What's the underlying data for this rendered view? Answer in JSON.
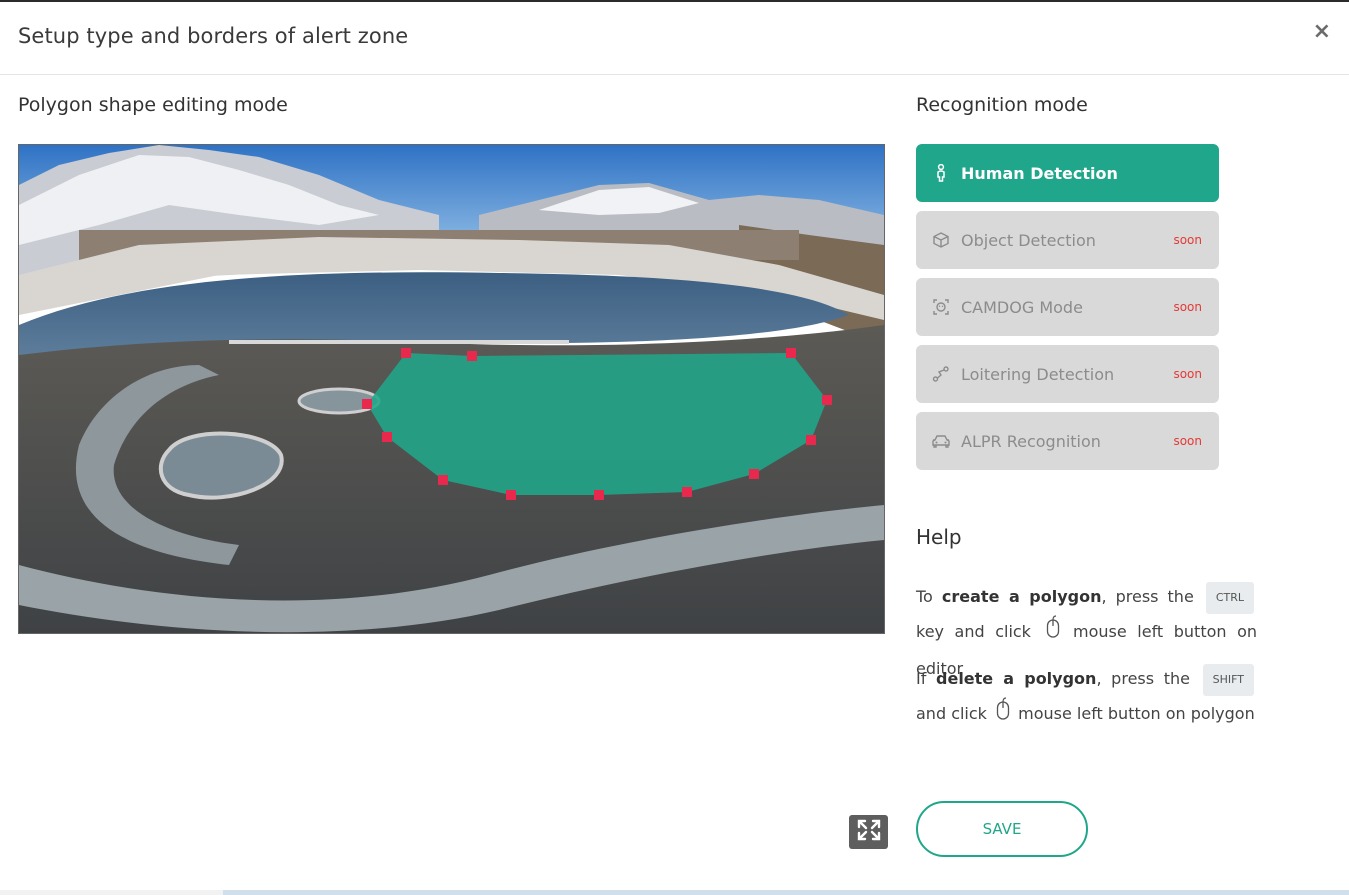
{
  "dialog": {
    "title": "Setup type and borders of alert zone",
    "close_label": "×"
  },
  "editor": {
    "title": "Polygon shape editing mode",
    "zone_color": "#20a68a",
    "handle_color": "#e8294d"
  },
  "recognition": {
    "title": "Recognition mode",
    "accent": "#20a68a",
    "modes": [
      {
        "label": "Human Detection",
        "icon": "person-icon",
        "active": true,
        "badge": ""
      },
      {
        "label": "Object Detection",
        "icon": "cube-icon",
        "active": false,
        "badge": "soon"
      },
      {
        "label": "CAMDOG Mode",
        "icon": "camdog-face-icon",
        "active": false,
        "badge": "soon"
      },
      {
        "label": "Loitering Detection",
        "icon": "route-icon",
        "active": false,
        "badge": "soon"
      },
      {
        "label": "ALPR Recognition",
        "icon": "car-icon",
        "active": false,
        "badge": "soon"
      }
    ]
  },
  "help": {
    "title": "Help",
    "create": {
      "text1": "To ",
      "bold": "create a polygon",
      "text2": ", press the ",
      "key": "CTRL",
      "text3": " key and click ",
      "text4": " mouse left button on editor"
    },
    "delete": {
      "text1": "If ",
      "bold": "delete a polygon",
      "text2": ", press the ",
      "key": "SHIFT",
      "text3": " and click ",
      "text4": " mouse left button on polygon"
    }
  },
  "actions": {
    "save_label": "SAVE",
    "fullscreen_icon": "expand-arrows-icon"
  }
}
